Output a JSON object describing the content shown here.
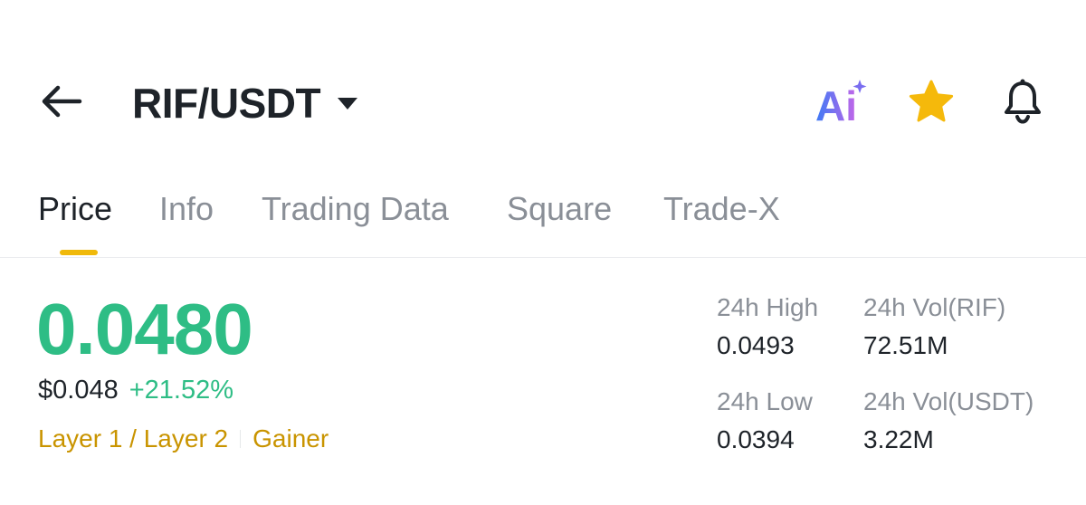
{
  "header": {
    "pair": "RIF/USDT",
    "back_icon": "arrow-left-icon",
    "caret_icon": "caret-down-icon",
    "ai_label": "Ai",
    "star_icon": "star-icon",
    "bell_icon": "bell-icon"
  },
  "tabs": [
    {
      "label": "Price",
      "active": true
    },
    {
      "label": "Info",
      "active": false
    },
    {
      "label": "Trading Data",
      "active": false
    },
    {
      "label": "Square",
      "active": false
    },
    {
      "label": "Trade-X",
      "active": false
    }
  ],
  "price": {
    "last": "0.0480",
    "fiat": "$0.048",
    "change": "+21.52%"
  },
  "tags": {
    "category": "Layer 1 / Layer 2",
    "badge": "Gainer"
  },
  "stats": {
    "high": {
      "label": "24h High",
      "value": "0.0493"
    },
    "vol_base": {
      "label": "24h Vol(RIF)",
      "value": "72.51M"
    },
    "low": {
      "label": "24h Low",
      "value": "0.0394"
    },
    "vol_quote": {
      "label": "24h Vol(USDT)",
      "value": "3.22M"
    }
  },
  "colors": {
    "up": "#2ebd85",
    "accent": "#f0b90b",
    "tag": "#c99400",
    "text_primary": "#1e2329",
    "text_secondary": "#8a8f97"
  }
}
